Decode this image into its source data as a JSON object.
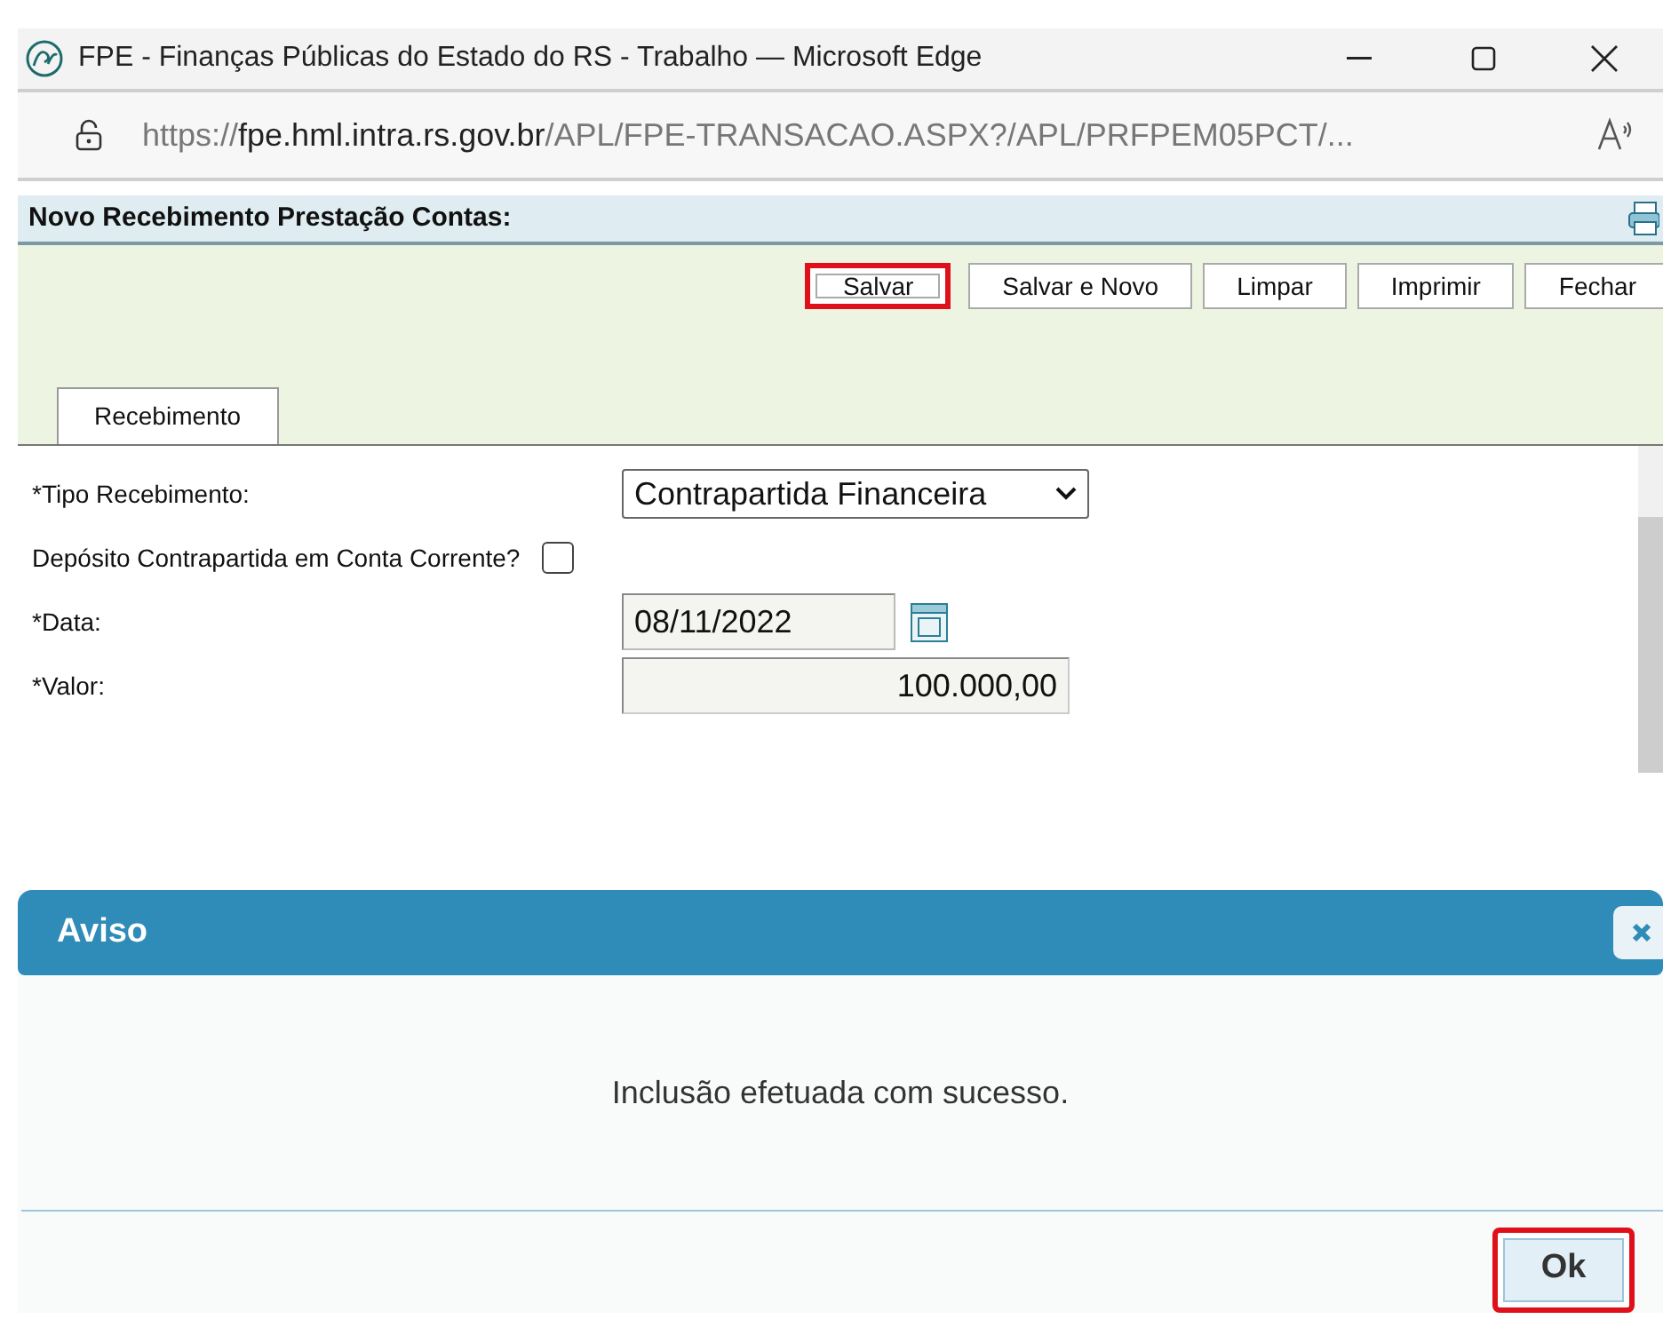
{
  "window": {
    "title": "FPE - Finanças Públicas do Estado do RS - Trabalho — Microsoft Edge"
  },
  "address_bar": {
    "url_prefix": "https://",
    "url_host": "fpe.hml.intra.rs.gov.br",
    "url_path": "/APL/FPE-TRANSACAO.ASPX?/APL/PRFPEM05PCT/..."
  },
  "page": {
    "title": "Novo Recebimento Prestação Contas:",
    "toolbar": [
      {
        "label": "Salvar",
        "highlighted": true
      },
      {
        "label": "Salvar e Novo",
        "highlighted": false
      },
      {
        "label": "Limpar",
        "highlighted": false
      },
      {
        "label": "Imprimir",
        "highlighted": false
      },
      {
        "label": "Fechar",
        "highlighted": false
      }
    ],
    "tabs": [
      {
        "label": "Recebimento",
        "selected": true
      }
    ],
    "fields": [
      {
        "kind": "select",
        "label": "*Tipo Recebimento:",
        "value": "Contrapartida Financeira"
      },
      {
        "kind": "checkbox",
        "label": "Depósito Contrapartida em Conta Corrente?",
        "checked": false
      },
      {
        "kind": "date",
        "label": "*Data:",
        "value": "08/11/2022"
      },
      {
        "kind": "number",
        "label": "*Valor:",
        "value": "100.000,00"
      }
    ]
  },
  "dialog": {
    "title": "Aviso",
    "message": "Inclusão efetuada com sucesso.",
    "buttons": [
      {
        "label": "Ok",
        "highlighted": true
      }
    ]
  }
}
